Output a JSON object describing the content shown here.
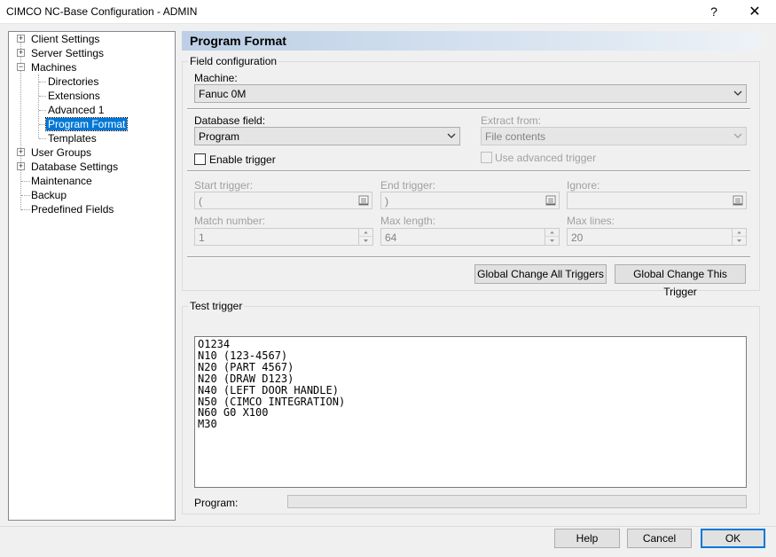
{
  "window": {
    "title": "CIMCO NC-Base Configuration - ADMIN",
    "help_glyph": "?",
    "close_glyph": "✕"
  },
  "tree": {
    "items": [
      {
        "label": "Client Settings",
        "expander": "+"
      },
      {
        "label": "Server Settings",
        "expander": "+"
      },
      {
        "label": "Machines",
        "expander": "−"
      },
      {
        "label": "Directories"
      },
      {
        "label": "Extensions"
      },
      {
        "label": "Advanced 1"
      },
      {
        "label": "Program Format",
        "selected": true
      },
      {
        "label": "Templates"
      },
      {
        "label": "User Groups",
        "expander": "+"
      },
      {
        "label": "Database Settings",
        "expander": "+"
      },
      {
        "label": "Maintenance"
      },
      {
        "label": "Backup"
      },
      {
        "label": "Predefined Fields"
      }
    ]
  },
  "page": {
    "title": "Program Format"
  },
  "field_config": {
    "group_title": "Field configuration",
    "machine_label": "Machine:",
    "machine_value": "Fanuc 0M",
    "db_field_label": "Database field:",
    "db_field_value": "Program",
    "extract_from_label": "Extract from:",
    "extract_from_value": "File contents",
    "enable_trigger_label": "Enable trigger",
    "enable_trigger_checked": false,
    "use_advanced_label": "Use advanced trigger",
    "use_advanced_checked": false,
    "start_trigger_label": "Start trigger:",
    "start_trigger_value": "(",
    "end_trigger_label": "End trigger:",
    "end_trigger_value": ")",
    "ignore_label": "Ignore:",
    "ignore_value": "",
    "match_number_label": "Match number:",
    "match_number_value": "1",
    "max_length_label": "Max length:",
    "max_length_value": "64",
    "max_lines_label": "Max lines:",
    "max_lines_value": "20",
    "global_all_label": "Global Change All Triggers",
    "global_this_label": "Global Change This Trigger"
  },
  "test_trigger": {
    "group_title": "Test trigger",
    "lines": [
      "O1234",
      "N10 (123-4567)",
      "N20 (PART 4567)",
      "N20 (DRAW D123)",
      "N40 (LEFT DOOR HANDLE)",
      "N50 (CIMCO INTEGRATION)",
      "N60 G0 X100",
      "M30"
    ],
    "program_label": "Program:"
  },
  "footer": {
    "help_label": "Help",
    "cancel_label": "Cancel",
    "ok_label": "OK"
  },
  "colors": {
    "selection": "#0078d7",
    "header_gradient_start": "#bccfe6",
    "default_button_border": "#0078d7"
  }
}
